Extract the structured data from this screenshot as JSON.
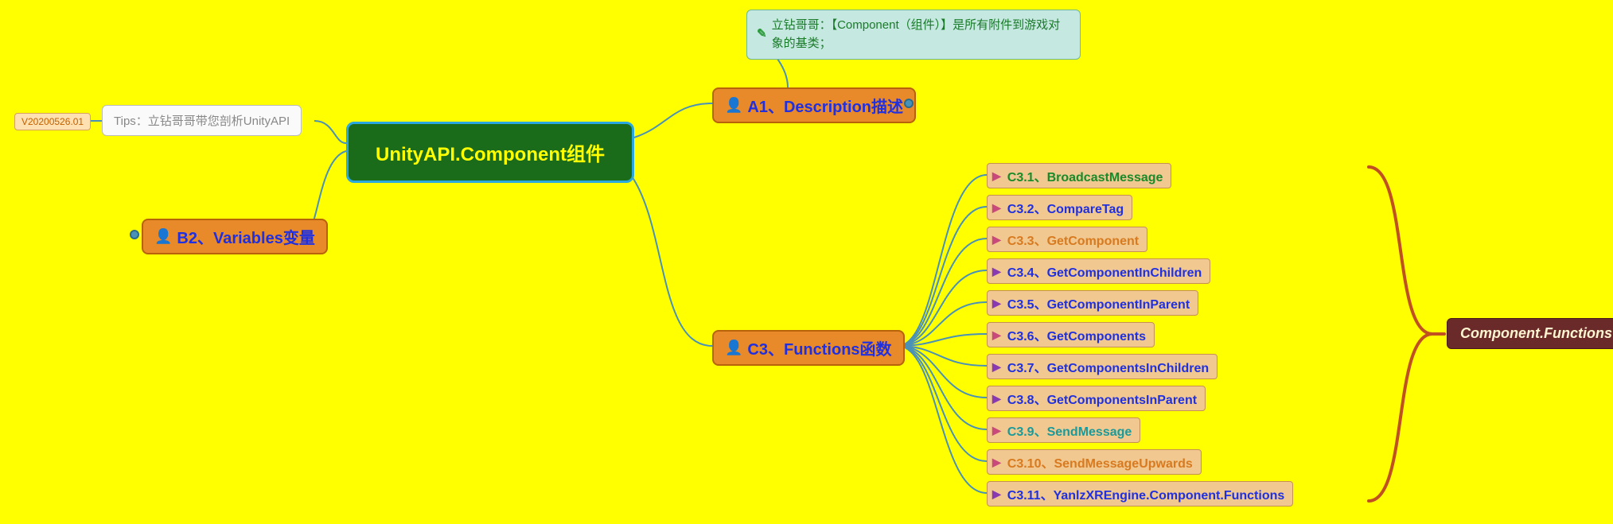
{
  "version": "V20200526.01",
  "tips": "Tips：立钻哥哥带您剖析UnityAPI",
  "root": "UnityAPI.Component组件",
  "note": "立钻哥哥：【Component（组件）】是所有附件到游戏对象的基类；",
  "a1": "A1、Description描述",
  "b2": "B2、Variables变量",
  "c3": "C3、Functions函数",
  "summary": "Component.Functions",
  "functions": [
    {
      "label": "C3.1、BroadcastMessage",
      "color": "#1a8a2a",
      "flag": "#c84a7a"
    },
    {
      "label": "C3.2、CompareTag",
      "color": "#2030e0",
      "flag": "#c84a7a"
    },
    {
      "label": "C3.3、GetComponent",
      "color": "#d87a20",
      "flag": "#c84a7a"
    },
    {
      "label": "C3.4、GetComponentInChildren",
      "color": "#2030e0",
      "flag": "#8a3ab0"
    },
    {
      "label": "C3.5、GetComponentInParent",
      "color": "#2030e0",
      "flag": "#8a3ab0"
    },
    {
      "label": "C3.6、GetComponents",
      "color": "#2030e0",
      "flag": "#c84a7a"
    },
    {
      "label": "C3.7、GetComponentsInChildren",
      "color": "#2030e0",
      "flag": "#8a3ab0"
    },
    {
      "label": "C3.8、GetComponentsInParent",
      "color": "#2030e0",
      "flag": "#8a3ab0"
    },
    {
      "label": "C3.9、SendMessage",
      "color": "#1a9a9a",
      "flag": "#c84a7a"
    },
    {
      "label": "C3.10、SendMessageUpwards",
      "color": "#d87a20",
      "flag": "#c84a7a"
    },
    {
      "label": "C3.11、YanlzXREngine.Component.Functions",
      "color": "#2030e0",
      "flag": "#8a3ab0"
    }
  ]
}
